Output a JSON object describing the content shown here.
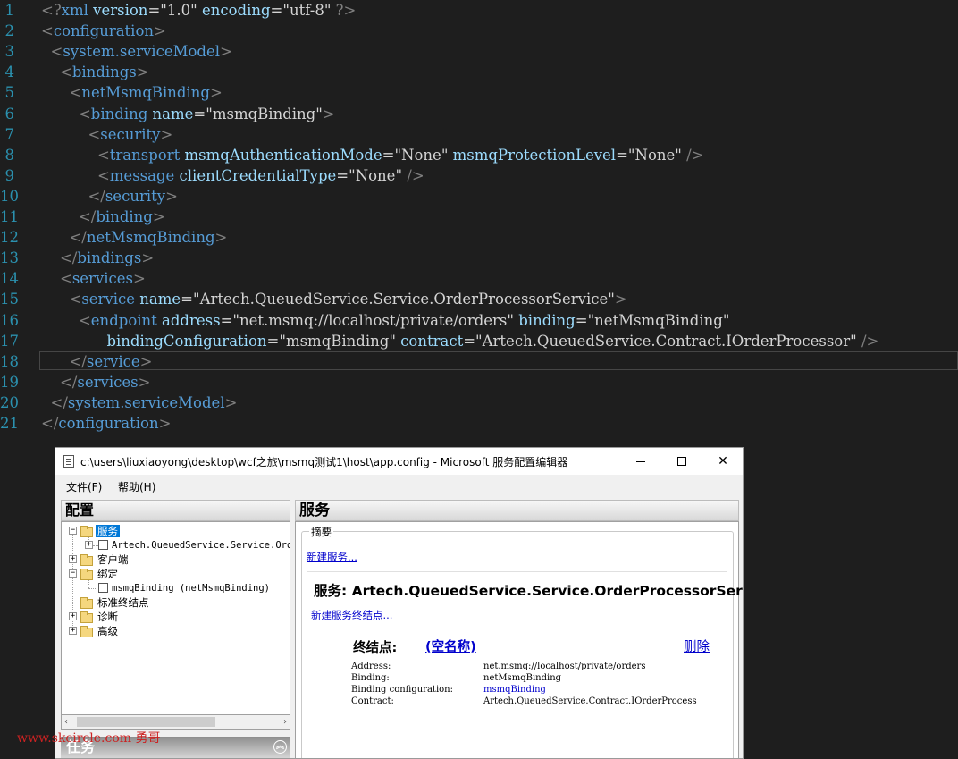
{
  "editor": {
    "lines": [
      {
        "n": "1",
        "parts": [
          [
            "br",
            "<?"
          ],
          [
            "tag",
            "xml"
          ],
          [
            "attr",
            " version"
          ],
          [
            "eq",
            "="
          ],
          [
            "q",
            "\""
          ],
          [
            "val",
            "1.0"
          ],
          [
            "q",
            "\""
          ],
          [
            "attr",
            " encoding"
          ],
          [
            "eq",
            "="
          ],
          [
            "q",
            "\""
          ],
          [
            "val",
            "utf-8"
          ],
          [
            "q",
            "\""
          ],
          [
            "br",
            " ?>"
          ]
        ]
      },
      {
        "n": "2",
        "parts": [
          [
            "br",
            "<"
          ],
          [
            "tag",
            "configuration"
          ],
          [
            "br",
            ">"
          ]
        ]
      },
      {
        "n": "3",
        "parts": [
          [
            "val",
            "  "
          ],
          [
            "br",
            "<"
          ],
          [
            "tag",
            "system.serviceModel"
          ],
          [
            "br",
            ">"
          ]
        ]
      },
      {
        "n": "4",
        "parts": [
          [
            "val",
            "    "
          ],
          [
            "br",
            "<"
          ],
          [
            "tag",
            "bindings"
          ],
          [
            "br",
            ">"
          ]
        ]
      },
      {
        "n": "5",
        "parts": [
          [
            "val",
            "      "
          ],
          [
            "br",
            "<"
          ],
          [
            "tag",
            "netMsmqBinding"
          ],
          [
            "br",
            ">"
          ]
        ]
      },
      {
        "n": "6",
        "parts": [
          [
            "val",
            "        "
          ],
          [
            "br",
            "<"
          ],
          [
            "tag",
            "binding"
          ],
          [
            "attr",
            " name"
          ],
          [
            "eq",
            "="
          ],
          [
            "q",
            "\""
          ],
          [
            "val",
            "msmqBinding"
          ],
          [
            "q",
            "\""
          ],
          [
            "br",
            ">"
          ]
        ]
      },
      {
        "n": "7",
        "parts": [
          [
            "val",
            "          "
          ],
          [
            "br",
            "<"
          ],
          [
            "tag",
            "security"
          ],
          [
            "br",
            ">"
          ]
        ]
      },
      {
        "n": "8",
        "parts": [
          [
            "val",
            "            "
          ],
          [
            "br",
            "<"
          ],
          [
            "tag",
            "transport"
          ],
          [
            "attr",
            " msmqAuthenticationMode"
          ],
          [
            "eq",
            "="
          ],
          [
            "q",
            "\""
          ],
          [
            "val",
            "None"
          ],
          [
            "q",
            "\""
          ],
          [
            "attr",
            " msmqProtectionLevel"
          ],
          [
            "eq",
            "="
          ],
          [
            "q",
            "\""
          ],
          [
            "val",
            "None"
          ],
          [
            "q",
            "\""
          ],
          [
            "br",
            " />"
          ]
        ]
      },
      {
        "n": "9",
        "parts": [
          [
            "val",
            "            "
          ],
          [
            "br",
            "<"
          ],
          [
            "tag",
            "message"
          ],
          [
            "attr",
            " clientCredentialType"
          ],
          [
            "eq",
            "="
          ],
          [
            "q",
            "\""
          ],
          [
            "val",
            "None"
          ],
          [
            "q",
            "\""
          ],
          [
            "br",
            " />"
          ]
        ]
      },
      {
        "n": "10",
        "parts": [
          [
            "val",
            "          "
          ],
          [
            "br",
            "</"
          ],
          [
            "tag",
            "security"
          ],
          [
            "br",
            ">"
          ]
        ]
      },
      {
        "n": "11",
        "parts": [
          [
            "val",
            "        "
          ],
          [
            "br",
            "</"
          ],
          [
            "tag",
            "binding"
          ],
          [
            "br",
            ">"
          ]
        ]
      },
      {
        "n": "12",
        "parts": [
          [
            "val",
            "      "
          ],
          [
            "br",
            "</"
          ],
          [
            "tag",
            "netMsmqBinding"
          ],
          [
            "br",
            ">"
          ]
        ]
      },
      {
        "n": "13",
        "parts": [
          [
            "val",
            "    "
          ],
          [
            "br",
            "</"
          ],
          [
            "tag",
            "bindings"
          ],
          [
            "br",
            ">"
          ]
        ]
      },
      {
        "n": "14",
        "parts": [
          [
            "val",
            "    "
          ],
          [
            "br",
            "<"
          ],
          [
            "tag",
            "services"
          ],
          [
            "br",
            ">"
          ]
        ]
      },
      {
        "n": "15",
        "parts": [
          [
            "val",
            "      "
          ],
          [
            "br",
            "<"
          ],
          [
            "tag",
            "service"
          ],
          [
            "attr",
            " name"
          ],
          [
            "eq",
            "="
          ],
          [
            "q",
            "\""
          ],
          [
            "val",
            "Artech.QueuedService.Service.OrderProcessorService"
          ],
          [
            "q",
            "\""
          ],
          [
            "br",
            ">"
          ]
        ]
      },
      {
        "n": "16",
        "parts": [
          [
            "val",
            "        "
          ],
          [
            "br",
            "<"
          ],
          [
            "tag",
            "endpoint"
          ],
          [
            "attr",
            " address"
          ],
          [
            "eq",
            "="
          ],
          [
            "q",
            "\""
          ],
          [
            "val",
            "net.msmq://localhost/private/orders"
          ],
          [
            "q",
            "\""
          ],
          [
            "attr",
            " binding"
          ],
          [
            "eq",
            "="
          ],
          [
            "q",
            "\""
          ],
          [
            "val",
            "netMsmqBinding"
          ],
          [
            "q",
            "\""
          ]
        ]
      },
      {
        "n": "17",
        "parts": [
          [
            "val",
            "              "
          ],
          [
            "attr",
            "bindingConfiguration"
          ],
          [
            "eq",
            "="
          ],
          [
            "q",
            "\""
          ],
          [
            "val",
            "msmqBinding"
          ],
          [
            "q",
            "\""
          ],
          [
            "attr",
            " contract"
          ],
          [
            "eq",
            "="
          ],
          [
            "q",
            "\""
          ],
          [
            "val",
            "Artech.QueuedService.Contract.IOrderProcessor"
          ],
          [
            "q",
            "\""
          ],
          [
            "br",
            " />"
          ]
        ]
      },
      {
        "n": "18",
        "parts": [
          [
            "val",
            "      "
          ],
          [
            "br",
            "</"
          ],
          [
            "tag",
            "service"
          ],
          [
            "br",
            ">"
          ]
        ],
        "current": true
      },
      {
        "n": "19",
        "parts": [
          [
            "val",
            "    "
          ],
          [
            "br",
            "</"
          ],
          [
            "tag",
            "services"
          ],
          [
            "br",
            ">"
          ]
        ]
      },
      {
        "n": "20",
        "parts": [
          [
            "val",
            "  "
          ],
          [
            "br",
            "</"
          ],
          [
            "tag",
            "system.serviceModel"
          ],
          [
            "br",
            ">"
          ]
        ]
      },
      {
        "n": "21",
        "parts": [
          [
            "br",
            "</"
          ],
          [
            "tag",
            "configuration"
          ],
          [
            "br",
            ">"
          ]
        ]
      }
    ]
  },
  "window": {
    "title": "c:\\users\\liuxiaoyong\\desktop\\wcf之旅\\msmq测试1\\host\\app.config - Microsoft 服务配置编辑器",
    "controls": {
      "close": "✕"
    },
    "menu": {
      "file": "文件(F)",
      "help": "帮助(H)"
    }
  },
  "config_pane": {
    "header": "配置",
    "tree": {
      "services": "服务",
      "service_item": "Artech.QueuedService.Service.OrderProcessorService",
      "client": "客户端",
      "bindings": "绑定",
      "binding_item": "msmqBinding (netMsmqBinding)",
      "std_endpoints": "标准终结点",
      "diagnostics": "诊断",
      "advanced": "高级"
    },
    "scroll": {
      "left": "‹",
      "right": "›"
    }
  },
  "tasks_pane": {
    "header": "任务",
    "collapse": "︽"
  },
  "service_pane": {
    "header": "服务",
    "summary_label": "摘要",
    "new_service": "新建服务...",
    "service_title": "服务: Artech.QueuedService.Service.OrderProcessorService",
    "new_endpoint": "新建服务终结点...",
    "endpoint_label": "终结点:",
    "endpoint_name": "(空名称)",
    "delete": "删除",
    "props": [
      {
        "key": "Address:",
        "value": "net.msmq://localhost/private/orders",
        "link": false
      },
      {
        "key": "Binding:",
        "value": "netMsmqBinding",
        "link": false
      },
      {
        "key": "Binding configuration:",
        "value": "msmqBinding",
        "link": true
      },
      {
        "key": "Contract:",
        "value": "Artech.QueuedService.Contract.IOrderProcess",
        "link": false
      }
    ]
  },
  "watermark": "www.skcircle.com 勇哥",
  "colors": {
    "editor_bg": "#1e1e1e",
    "tag": "#569cd6",
    "attr": "#9cdcfe",
    "line_number": "#2b91af",
    "link": "#0000cc",
    "selection": "#0078d7"
  }
}
